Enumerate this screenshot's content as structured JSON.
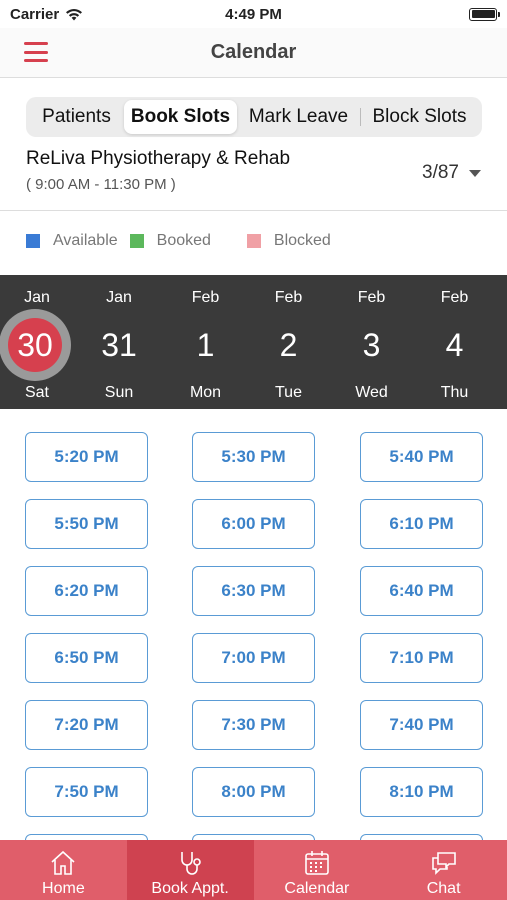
{
  "status_bar": {
    "carrier": "Carrier",
    "time": "4:49 PM"
  },
  "nav": {
    "title": "Calendar",
    "menu_icon": "hamburger-icon"
  },
  "segments": [
    {
      "label": "Patients",
      "active": false
    },
    {
      "label": "Book Slots",
      "active": true
    },
    {
      "label": "Mark Leave",
      "active": false
    },
    {
      "label": "Block Slots",
      "active": false
    }
  ],
  "clinic": {
    "name": "ReLiva Physiotherapy & Rehab",
    "hours": "( 9:00 AM - 11:30 PM )",
    "count": "3/87"
  },
  "legend": [
    {
      "label": "Available",
      "color": "#3a7bd5"
    },
    {
      "label": "Booked",
      "color": "#5cb85c"
    },
    {
      "label": "Blocked",
      "color": "#f0a0a5"
    }
  ],
  "dates": [
    {
      "month": "Jan",
      "day": "30",
      "dow": "Sat",
      "selected": true
    },
    {
      "month": "Jan",
      "day": "31",
      "dow": "Sun",
      "selected": false
    },
    {
      "month": "Feb",
      "day": "1",
      "dow": "Mon",
      "selected": false
    },
    {
      "month": "Feb",
      "day": "2",
      "dow": "Tue",
      "selected": false
    },
    {
      "month": "Feb",
      "day": "3",
      "dow": "Wed",
      "selected": false
    },
    {
      "month": "Feb",
      "day": "4",
      "dow": "Thu",
      "selected": false
    }
  ],
  "slots": [
    "5:20 PM",
    "5:30 PM",
    "5:40 PM",
    "5:50 PM",
    "6:00 PM",
    "6:10 PM",
    "6:20 PM",
    "6:30 PM",
    "6:40 PM",
    "6:50 PM",
    "7:00 PM",
    "7:10 PM",
    "7:20 PM",
    "7:30 PM",
    "7:40 PM",
    "7:50 PM",
    "8:00 PM",
    "8:10 PM",
    "",
    "",
    ""
  ],
  "tabs": [
    {
      "label": "Home",
      "icon": "home-icon",
      "active": false
    },
    {
      "label": "Book Appt.",
      "icon": "stethoscope-icon",
      "active": true
    },
    {
      "label": "Calendar",
      "icon": "calendar-icon",
      "active": false
    },
    {
      "label": "Chat",
      "icon": "chat-icon",
      "active": false
    }
  ],
  "colors": {
    "accent": "#d6404e",
    "tab_bar": "#e05e6a",
    "slot_blue": "#3b82c9",
    "date_strip": "#3a3a3a"
  }
}
